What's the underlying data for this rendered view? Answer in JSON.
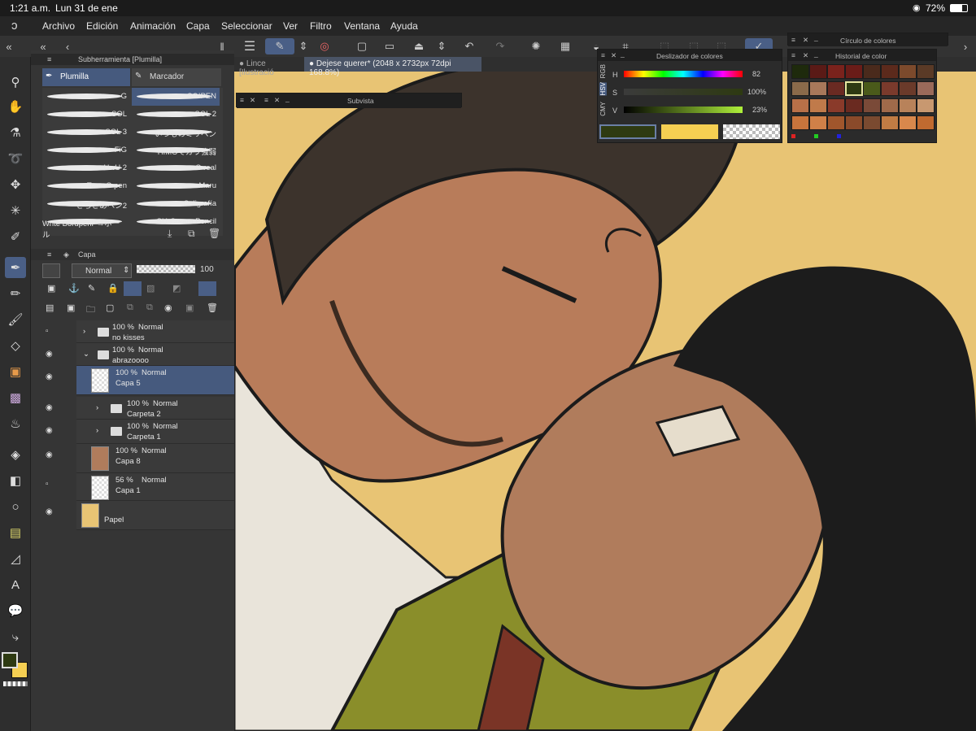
{
  "status": {
    "time": "1:21 a.m.",
    "date": "Lun 31 de ene",
    "battery": "72%"
  },
  "menu": [
    "Archivo",
    "Edición",
    "Animación",
    "Capa",
    "Seleccionar",
    "Ver",
    "Filtro",
    "Ventana",
    "Ayuda"
  ],
  "tabs": [
    {
      "label": "Lince [Ilustració"
    },
    {
      "label": "Dejese querer* (2048 x 2732px 72dpi 168.8%)"
    }
  ],
  "subtool": {
    "title": "Subherramienta [Plumilla]",
    "tabs": [
      "Plumilla",
      "Marcador"
    ],
    "brushes": [
      [
        "G",
        "SOIPEN"
      ],
      [
        "SOL",
        "SOL 2"
      ],
      [
        "SOL 3",
        "いつものミリペン"
      ],
      [
        "FiG",
        "HIMOでガラ強弱"
      ],
      [
        "UwU 2",
        "G real"
      ],
      [
        "Tone G pen",
        "Maru"
      ],
      [
        "さらさあペン2",
        "Caligrafía"
      ],
      [
        "Write BordpenP→ボール",
        "SU-Cream Pencil"
      ]
    ]
  },
  "layerpanel": {
    "title": "Capa",
    "blend": "Normal",
    "opacity": "100",
    "layers": [
      {
        "pct": "100 %",
        "mode": "Normal",
        "name": "no kisses",
        "kind": "folder",
        "visible": false
      },
      {
        "pct": "100 %",
        "mode": "Normal",
        "name": "abrazoooo",
        "kind": "folder-open",
        "visible": true
      },
      {
        "pct": "100 %",
        "mode": "Normal",
        "name": "Capa 5",
        "kind": "raster",
        "visible": true,
        "selected": true
      },
      {
        "pct": "100 %",
        "mode": "Normal",
        "name": "Carpeta 2",
        "kind": "folder",
        "visible": true
      },
      {
        "pct": "100 %",
        "mode": "Normal",
        "name": "Carpeta 1",
        "kind": "folder",
        "visible": true
      },
      {
        "pct": "100 %",
        "mode": "Normal",
        "name": "Capa 8",
        "kind": "raster",
        "visible": true
      },
      {
        "pct": "56 %",
        "mode": "Normal",
        "name": "Capa 1",
        "kind": "raster",
        "visible": false
      },
      {
        "pct": "",
        "mode": "",
        "name": "Papel",
        "kind": "paper",
        "visible": true
      }
    ]
  },
  "subvista": {
    "title": "Subvista"
  },
  "colorslider": {
    "title": "Deslizador de colores",
    "tabs": [
      "RGB",
      "HSV",
      "CMY"
    ],
    "h": "82",
    "s": "100%",
    "v": "23%",
    "labels": [
      "H",
      "S",
      "V"
    ]
  },
  "colorwheel": {
    "title": "Círculo de colores"
  },
  "colorhistory": {
    "title": "Historial de color"
  },
  "colors": {
    "main": "#2e3a12",
    "sub": "#f5cf52",
    "accent": "#4a5f86",
    "paper": "#e8c474"
  },
  "tools": [
    "hand",
    "zoom",
    "move",
    "lasso",
    "wand",
    "eyedropper",
    "pen",
    "pencil",
    "brush",
    "eraser",
    "fill",
    "gradient",
    "figure",
    "frame",
    "ruler",
    "text",
    "balloon",
    "correct"
  ]
}
